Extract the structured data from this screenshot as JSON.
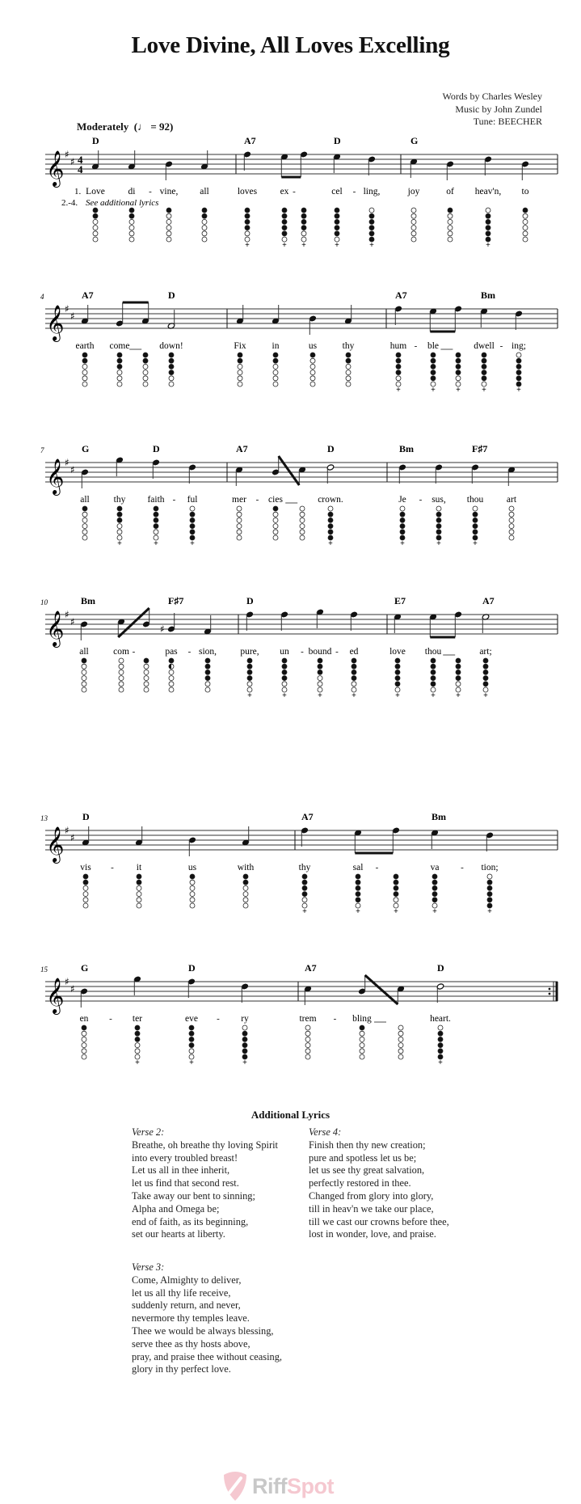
{
  "title": "Love Divine, All Loves Excelling",
  "credits": [
    "Words by Charles Wesley",
    "Music by John Zundel",
    "Tune: BEECHER"
  ],
  "tempo": {
    "label": "Moderately",
    "bpm": "92"
  },
  "key_signature": "D major (2 sharps)",
  "time_signature": "4/4",
  "instrument": "Tin whistle (D)",
  "verse_markers": {
    "v1": "1.",
    "v2to4": "2.-4.",
    "v2to4_text": "See additional lyrics"
  },
  "systems": [
    {
      "measure_number": "",
      "measures": [
        {
          "notes": [
            {
              "p": 3,
              "d": "q",
              "chord": "D",
              "lyric": "Love",
              "f": "110000",
              "hy": false
            },
            {
              "p": 3,
              "d": "q",
              "lyric": "di",
              "f": "110000",
              "hy": true
            },
            {
              "p": 4,
              "d": "q",
              "lyric": "vine,",
              "f": "100000"
            },
            {
              "p": 3,
              "d": "q",
              "lyric": "all",
              "f": "110000"
            }
          ]
        },
        {
          "notes": [
            {
              "p": 8,
              "d": "q",
              "chord": "A7",
              "lyric": "loves",
              "f": "111100",
              "plus": true
            },
            {
              "p": 7,
              "d": "e",
              "beam": "start",
              "lyric": "ex",
              "f": "111110",
              "plus": true,
              "hy": true
            },
            {
              "p": 8,
              "d": "e",
              "beam": "end",
              "lyric": "",
              "f": "111100",
              "plus": true
            },
            {
              "p": 7,
              "d": "q",
              "chord": "D",
              "lyric": "cel",
              "f": "111110",
              "plus": true,
              "hy": true
            },
            {
              "p": 6,
              "d": "q",
              "lyric": "ling,",
              "f": "011111",
              "plus": true
            }
          ]
        },
        {
          "notes": [
            {
              "p": 5,
              "d": "q",
              "chord": "G",
              "lyric": "joy",
              "f": "000000"
            },
            {
              "p": 4,
              "d": "q",
              "lyric": "of",
              "f": "100000"
            },
            {
              "p": 6,
              "d": "q",
              "lyric": "heav'n,",
              "f": "011111",
              "plus": true
            },
            {
              "p": 4,
              "d": "q",
              "lyric": "to",
              "f": "100000"
            }
          ]
        }
      ]
    },
    {
      "measure_number": "4",
      "measures": [
        {
          "notes": [
            {
              "p": 3,
              "d": "q",
              "chord": "A7",
              "lyric": "earth",
              "f": "110000"
            },
            {
              "p": 2,
              "d": "e",
              "beam": "start",
              "lyric": "come",
              "f": "111000",
              "ext": true
            },
            {
              "p": 3,
              "d": "e",
              "beam": "end",
              "lyric": "",
              "f": "110000"
            },
            {
              "p": 1,
              "d": "h",
              "chord": "D",
              "lyric": "down!",
              "f": "111100"
            }
          ]
        },
        {
          "notes": [
            {
              "p": 3,
              "d": "q",
              "lyric": "Fix",
              "f": "110000"
            },
            {
              "p": 3,
              "d": "q",
              "lyric": "in",
              "f": "110000"
            },
            {
              "p": 4,
              "d": "q",
              "lyric": "us",
              "f": "100000"
            },
            {
              "p": 3,
              "d": "q",
              "lyric": "thy",
              "f": "110000"
            }
          ]
        },
        {
          "notes": [
            {
              "p": 8,
              "d": "q",
              "chord": "A7",
              "lyric": "hum",
              "f": "111100",
              "plus": true,
              "hy": true
            },
            {
              "p": 7,
              "d": "e",
              "beam": "start",
              "lyric": "ble",
              "f": "111110",
              "plus": true,
              "ext": true
            },
            {
              "p": 8,
              "d": "e",
              "beam": "end",
              "lyric": "",
              "f": "111100",
              "plus": true
            },
            {
              "p": 7,
              "d": "q",
              "chord": "Bm",
              "lyric": "dwell",
              "f": "111110",
              "plus": true,
              "hy": true
            },
            {
              "p": 6,
              "d": "q",
              "lyric": "ing;",
              "f": "011111",
              "plus": true
            }
          ]
        }
      ]
    },
    {
      "measure_number": "7",
      "measures": [
        {
          "notes": [
            {
              "p": 4,
              "d": "q",
              "chord": "G",
              "lyric": "all",
              "f": "100000"
            },
            {
              "p": 9,
              "d": "q",
              "lyric": "thy",
              "f": "111000",
              "plus": true
            },
            {
              "p": 8,
              "d": "q",
              "chord": "D",
              "lyric": "faith",
              "f": "111100",
              "plus": true,
              "hy": true
            },
            {
              "p": 6,
              "d": "q",
              "lyric": "ful",
              "f": "011111",
              "plus": true
            }
          ]
        },
        {
          "notes": [
            {
              "p": 5,
              "d": "q",
              "chord": "A7",
              "lyric": "mer",
              "f": "000000",
              "hy": true
            },
            {
              "p": 4,
              "d": "e",
              "beam": "start",
              "lyric": "cies",
              "f": "100000",
              "ext": true
            },
            {
              "p": 5,
              "d": "e",
              "beam": "end",
              "lyric": "",
              "f": "000000"
            },
            {
              "p": 6,
              "d": "h",
              "chord": "D",
              "lyric": "crown.",
              "f": "011111",
              "plus": true
            }
          ]
        },
        {
          "notes": [
            {
              "p": 6,
              "d": "q",
              "chord": "Bm",
              "lyric": "Je",
              "f": "011111",
              "plus": true,
              "hy": true
            },
            {
              "p": 6,
              "d": "q",
              "lyric": "sus,",
              "f": "011111",
              "plus": true
            },
            {
              "p": 6,
              "d": "q",
              "chord": "F♯7",
              "lyric": "thou",
              "f": "011111",
              "plus": true
            },
            {
              "p": 5,
              "d": "q",
              "lyric": "art",
              "f": "000000"
            }
          ]
        }
      ]
    },
    {
      "measure_number": "10",
      "measures": [
        {
          "notes": [
            {
              "p": 4,
              "d": "q",
              "chord": "Bm",
              "lyric": "all",
              "f": "100000"
            },
            {
              "p": 5,
              "d": "e",
              "beam": "start",
              "lyric": "com",
              "f": "000000",
              "hy": true
            },
            {
              "p": 4,
              "d": "e",
              "beam": "end",
              "lyric": "",
              "f": "100000"
            },
            {
              "p": 2,
              "d": "q",
              "acc": "♯",
              "chord": "F♯7",
              "lyric": "pas",
              "f": "1h0000",
              "hy": true
            },
            {
              "p": 1,
              "d": "q",
              "lyric": "sion,",
              "f": "111100"
            }
          ]
        },
        {
          "notes": [
            {
              "p": 8,
              "d": "q",
              "chord": "D",
              "lyric": "pure,",
              "f": "111100",
              "plus": true
            },
            {
              "p": 8,
              "d": "q",
              "lyric": "un",
              "f": "111100",
              "plus": true,
              "hy": true
            },
            {
              "p": 9,
              "d": "q",
              "lyric": "bound",
              "f": "111000",
              "plus": true,
              "hy": true
            },
            {
              "p": 8,
              "d": "q",
              "lyric": "ed",
              "f": "111100",
              "plus": true
            }
          ]
        },
        {
          "notes": [
            {
              "p": 7,
              "d": "q",
              "chord": "E7",
              "lyric": "love",
              "f": "111110",
              "plus": true
            },
            {
              "p": 7,
              "d": "e",
              "beam": "start",
              "lyric": "thou",
              "f": "111110",
              "plus": true,
              "ext": true
            },
            {
              "p": 8,
              "d": "e",
              "beam": "end",
              "lyric": "",
              "f": "111100",
              "plus": true
            },
            {
              "p": 7,
              "d": "h",
              "chord": "A7",
              "lyric": "art;",
              "f": "111110",
              "plus": true
            }
          ]
        }
      ]
    },
    {
      "measure_number": "13",
      "measures": [
        {
          "notes": [
            {
              "p": 3,
              "d": "q",
              "chord": "D",
              "lyric": "vis",
              "f": "110000",
              "hy": true
            },
            {
              "p": 3,
              "d": "q",
              "lyric": "it",
              "f": "110000"
            },
            {
              "p": 4,
              "d": "q",
              "lyric": "us",
              "f": "100000"
            },
            {
              "p": 3,
              "d": "q",
              "lyric": "with",
              "f": "110000"
            }
          ]
        },
        {
          "notes": [
            {
              "p": 8,
              "d": "q",
              "chord": "A7",
              "lyric": "thy",
              "f": "111100",
              "plus": true
            },
            {
              "p": 7,
              "d": "e",
              "beam": "start",
              "lyric": "sal",
              "f": "111110",
              "plus": true,
              "hy": true
            },
            {
              "p": 8,
              "d": "e",
              "beam": "end",
              "lyric": "",
              "f": "111100",
              "plus": true
            },
            {
              "p": 7,
              "d": "q",
              "chord": "Bm",
              "lyric": "va",
              "f": "111110",
              "plus": true,
              "hy": true
            },
            {
              "p": 6,
              "d": "q",
              "lyric": "tion;",
              "f": "011111",
              "plus": true
            }
          ]
        }
      ]
    },
    {
      "measure_number": "15",
      "final": true,
      "measures": [
        {
          "notes": [
            {
              "p": 4,
              "d": "q",
              "chord": "G",
              "lyric": "en",
              "f": "100000",
              "hy": true
            },
            {
              "p": 9,
              "d": "q",
              "lyric": "ter",
              "f": "111000",
              "plus": true
            },
            {
              "p": 8,
              "d": "q",
              "chord": "D",
              "lyric": "eve",
              "f": "111100",
              "plus": true,
              "hy": true
            },
            {
              "p": 6,
              "d": "q",
              "lyric": "ry",
              "f": "011111",
              "plus": true
            }
          ]
        },
        {
          "notes": [
            {
              "p": 5,
              "d": "q",
              "chord": "A7",
              "lyric": "trem",
              "f": "000000",
              "hy": true
            },
            {
              "p": 4,
              "d": "e",
              "beam": "start",
              "lyric": "bling",
              "f": "100000",
              "ext": true
            },
            {
              "p": 5,
              "d": "e",
              "beam": "end",
              "lyric": "",
              "f": "000000"
            },
            {
              "p": 6,
              "d": "h",
              "chord": "D",
              "lyric": "heart.",
              "f": "011111",
              "plus": true
            }
          ]
        }
      ]
    }
  ],
  "additional_lyrics": {
    "heading": "Additional Lyrics",
    "verses": [
      {
        "label": "Verse 2:",
        "lines": [
          "Breathe, oh breathe thy loving Spirit",
          "into every troubled breast!",
          "Let us all in thee inherit,",
          "let us find that second rest.",
          "Take away our bent to sinning;",
          "Alpha and Omega be;",
          "end of faith, as its beginning,",
          "set our hearts at liberty."
        ]
      },
      {
        "label": "Verse 3:",
        "lines": [
          "Come, Almighty to deliver,",
          "let us all thy life receive,",
          "suddenly return, and never,",
          "nevermore thy temples leave.",
          "Thee we would be always blessing,",
          "serve thee as thy hosts above,",
          "pray, and praise thee without ceasing,",
          "glory in thy perfect love."
        ]
      },
      {
        "label": "Verse 4:",
        "lines": [
          "Finish then thy new creation;",
          "pure and spotless let us be;",
          "let us see thy great salvation,",
          "perfectly restored in thee.",
          "Changed from glory into glory,",
          "till in heav'n we take our place,",
          "till we cast our crowns before thee,",
          "lost in wonder, love, and praise."
        ]
      }
    ]
  },
  "logo": {
    "part1": "Riff",
    "part2": "Spot"
  }
}
